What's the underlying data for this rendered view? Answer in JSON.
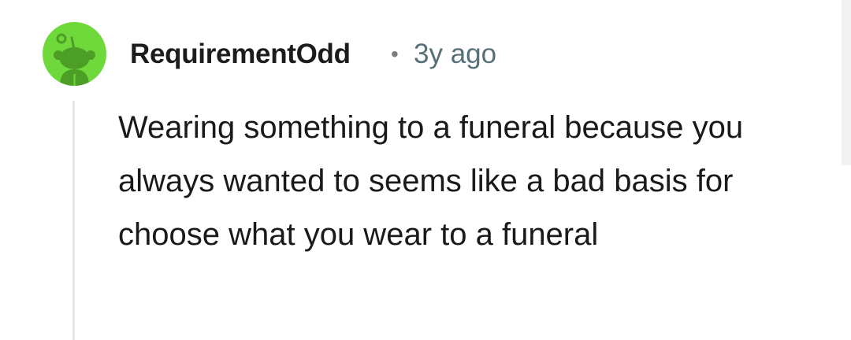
{
  "comment": {
    "author": "RequirementOdd",
    "separator": "•",
    "time": "3y ago",
    "body": "Wearing something to a funeral because you always wanted to seems like a bad basis for choose what you wear to a funeral"
  },
  "avatar": {
    "icon": "snoo-avatar-icon",
    "background_color": "#6fd93b"
  },
  "colors": {
    "username": "#1c1c1c",
    "timestamp": "#576f76",
    "thread_line": "#e6e6e6"
  }
}
